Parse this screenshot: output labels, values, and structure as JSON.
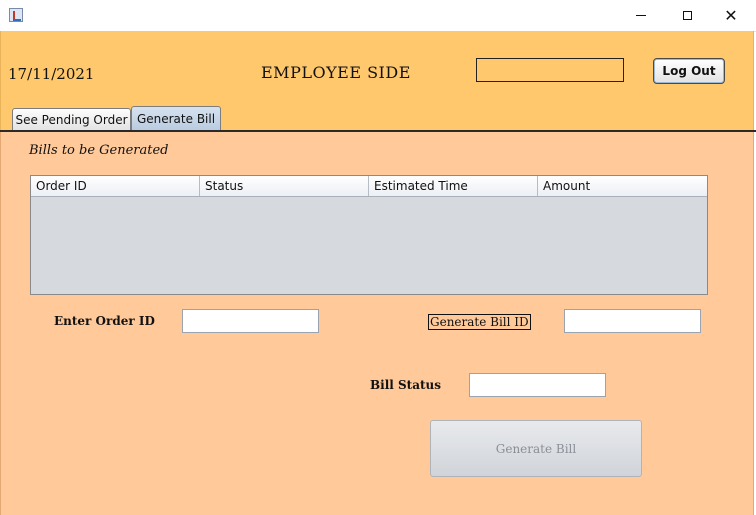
{
  "window": {
    "icon": "java-app-icon",
    "controls": {
      "minimize": "minimize-icon",
      "maximize": "maximize-icon",
      "close": "✕"
    }
  },
  "header": {
    "date": "17/11/2021",
    "title": "EMPLOYEE SIDE",
    "field_value": "",
    "logout_label": "Log Out"
  },
  "tabs": [
    {
      "label": "See Pending Order",
      "selected": false
    },
    {
      "label": "Generate Bill",
      "selected": true
    }
  ],
  "main": {
    "section_title": "Bills to be Generated",
    "table": {
      "columns": [
        "Order ID",
        "Status",
        "Estimated Time",
        "Amount"
      ],
      "rows": []
    },
    "order_id_label": "Enter Order ID",
    "order_id_value": "",
    "generate_bill_id_label": "Generate Bill ID",
    "generate_bill_id_value": "",
    "bill_status_label": "Bill Status",
    "bill_status_value": "",
    "generate_button_label": "Generate Bill"
  },
  "colors": {
    "header_bg": "#ffc86c",
    "panel_bg": "#ffc999",
    "table_bg": "#d6d9de"
  }
}
